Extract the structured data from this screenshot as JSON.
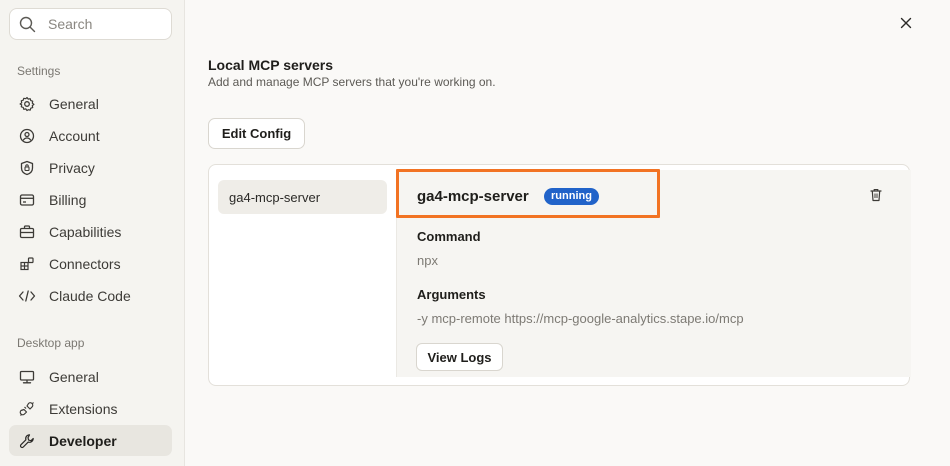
{
  "search": {
    "placeholder": "Search"
  },
  "sidebar": {
    "settings_title": "Settings",
    "settings_items": [
      {
        "label": "General",
        "icon": "gear-icon"
      },
      {
        "label": "Account",
        "icon": "account-icon"
      },
      {
        "label": "Privacy",
        "icon": "shield-icon"
      },
      {
        "label": "Billing",
        "icon": "card-icon"
      },
      {
        "label": "Capabilities",
        "icon": "briefcase-icon"
      },
      {
        "label": "Connectors",
        "icon": "connectors-icon"
      },
      {
        "label": "Claude Code",
        "icon": "code-icon"
      }
    ],
    "desktop_title": "Desktop app",
    "desktop_items": [
      {
        "label": "General",
        "icon": "monitor-icon"
      },
      {
        "label": "Extensions",
        "icon": "plug-icon"
      },
      {
        "label": "Developer",
        "icon": "wrench-icon",
        "active": true
      }
    ]
  },
  "main": {
    "title": "Local MCP servers",
    "subtitle": "Add and manage MCP servers that you're working on.",
    "edit_config_label": "Edit Config",
    "servers": [
      {
        "name": "ga4-mcp-server"
      }
    ],
    "detail": {
      "name": "ga4-mcp-server",
      "status": "running",
      "status_color": "#2163c9",
      "command_label": "Command",
      "command_value": "npx",
      "arguments_label": "Arguments",
      "arguments_value": "-y mcp-remote https://mcp-google-analytics.stape.io/mcp",
      "view_logs_label": "View Logs"
    }
  },
  "colors": {
    "highlight": "#f27323",
    "accent": "#2163c9"
  }
}
